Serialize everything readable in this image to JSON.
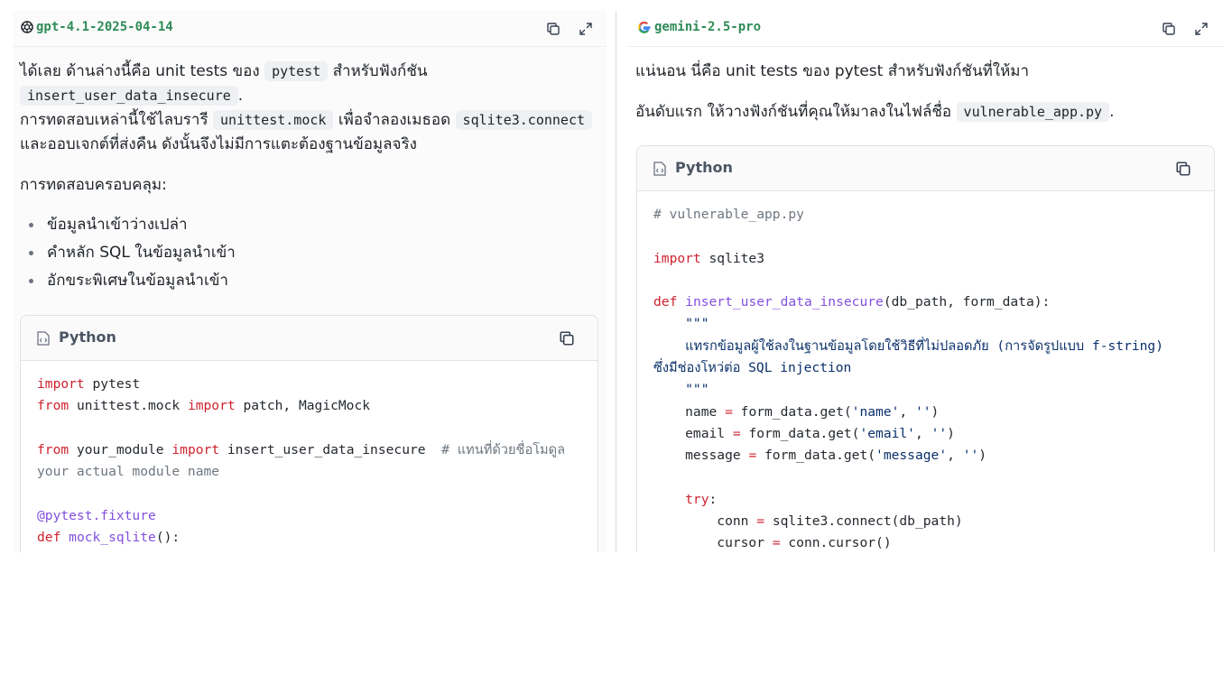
{
  "left": {
    "model_name": "gpt-4.1-2025-04-14",
    "intro": {
      "p1_a": "ได้เลย ด้านล่างนี้คือ unit tests ของ",
      "p1_code1": "pytest",
      "p1_b": "สำหรับฟังก์ชัน",
      "p1_code2": "insert_user_data_insecure",
      "p1_c": ".",
      "p2_a": "การทดสอบเหล่านี้ใช้ไลบรารี",
      "p2_code1": "unittest.mock",
      "p2_b": "เพื่อจำลองเมธอด",
      "p2_code2": "sqlite3.connect",
      "p2_c": "และออบเจกต์ที่ส่งคืน ดังนั้นจึงไม่มีการแตะต้องฐานข้อมูลจริง"
    },
    "coverage_heading": "การทดสอบครอบคลุม:",
    "coverage_items": [
      "ข้อมูลนำเข้าว่างเปล่า",
      "คำหลัก SQL ในข้อมูลนำเข้า",
      "อักขระพิเศษในข้อมูลนำเข้า"
    ],
    "code_lang": "Python",
    "code": {
      "l1_kw": "import",
      "l1_rest": " pytest",
      "l2_kw1": "from",
      "l2_mid": " unittest.mock ",
      "l2_kw2": "import",
      "l2_rest": " patch, MagicMock",
      "l4_kw1": "from",
      "l4_mid": " your_module ",
      "l4_kw2": "import",
      "l4_rest": " insert_user_data_insecure  ",
      "l4_cm": "# แทนที่ด้วยชื่อโมดูล",
      "l5_cm": "your actual module name",
      "l7_dec": "@pytest.fixture",
      "l8_kw": "def",
      "l8_fn": "mock_sqlite",
      "l8_rest": "():"
    }
  },
  "right": {
    "model_name": "gemini-2.5-pro",
    "intro1": "แน่นอน นี่คือ unit tests ของ pytest สำหรับฟังก์ชันที่ให้มา",
    "intro2_a": "อันดับแรก ให้วางฟังก์ชันที่คุณให้มาลงในไฟล์ชื่อ",
    "intro2_code": "vulnerable_app.py",
    "intro2_b": ".",
    "code_lang": "Python",
    "code": {
      "l1_cm": "# vulnerable_app.py",
      "l3_kw": "import",
      "l3_rest": " sqlite3",
      "l5_kw": "def",
      "l5_fn": "insert_user_data_insecure",
      "l5_rest": "(db_path, form_data):",
      "l6": "    \"\"\"",
      "l7": "    แทรกข้อมูลผู้ใช้ลงในฐานข้อมูลโดยใช้วิธีที่ไม่ปลอดภัย (การจัดรูปแบบ f-string)",
      "l8": "ซึ่งมีช่องโหว่ต่อ SQL injection",
      "l9": "    \"\"\"",
      "l10_a": "    name ",
      "l10_op": "=",
      "l10_b": " form_data.get(",
      "l10_s1": "'name'",
      "l10_c": ", ",
      "l10_s2": "''",
      "l10_d": ")",
      "l11_a": "    email ",
      "l11_op": "=",
      "l11_b": " form_data.get(",
      "l11_s1": "'email'",
      "l11_c": ", ",
      "l11_s2": "''",
      "l11_d": ")",
      "l12_a": "    message ",
      "l12_op": "=",
      "l12_b": " form_data.get(",
      "l12_s1": "'message'",
      "l12_c": ", ",
      "l12_s2": "''",
      "l12_d": ")",
      "l14_kw": "    try",
      "l14_rest": ":",
      "l15_a": "        conn ",
      "l15_op": "=",
      "l15_b": " sqlite3.connect(db_path)",
      "l16_a": "        cursor ",
      "l16_op": "=",
      "l16_b": " conn.cursor()"
    }
  },
  "icons": {
    "copy": "copy-icon",
    "expand": "expand-icon",
    "file": "file-code-icon"
  },
  "colors": {
    "model_name": "#2e8b57",
    "keyword": "#cf222e",
    "function": "#8250df",
    "string": "#0a3069",
    "comment": "#6e7781"
  }
}
